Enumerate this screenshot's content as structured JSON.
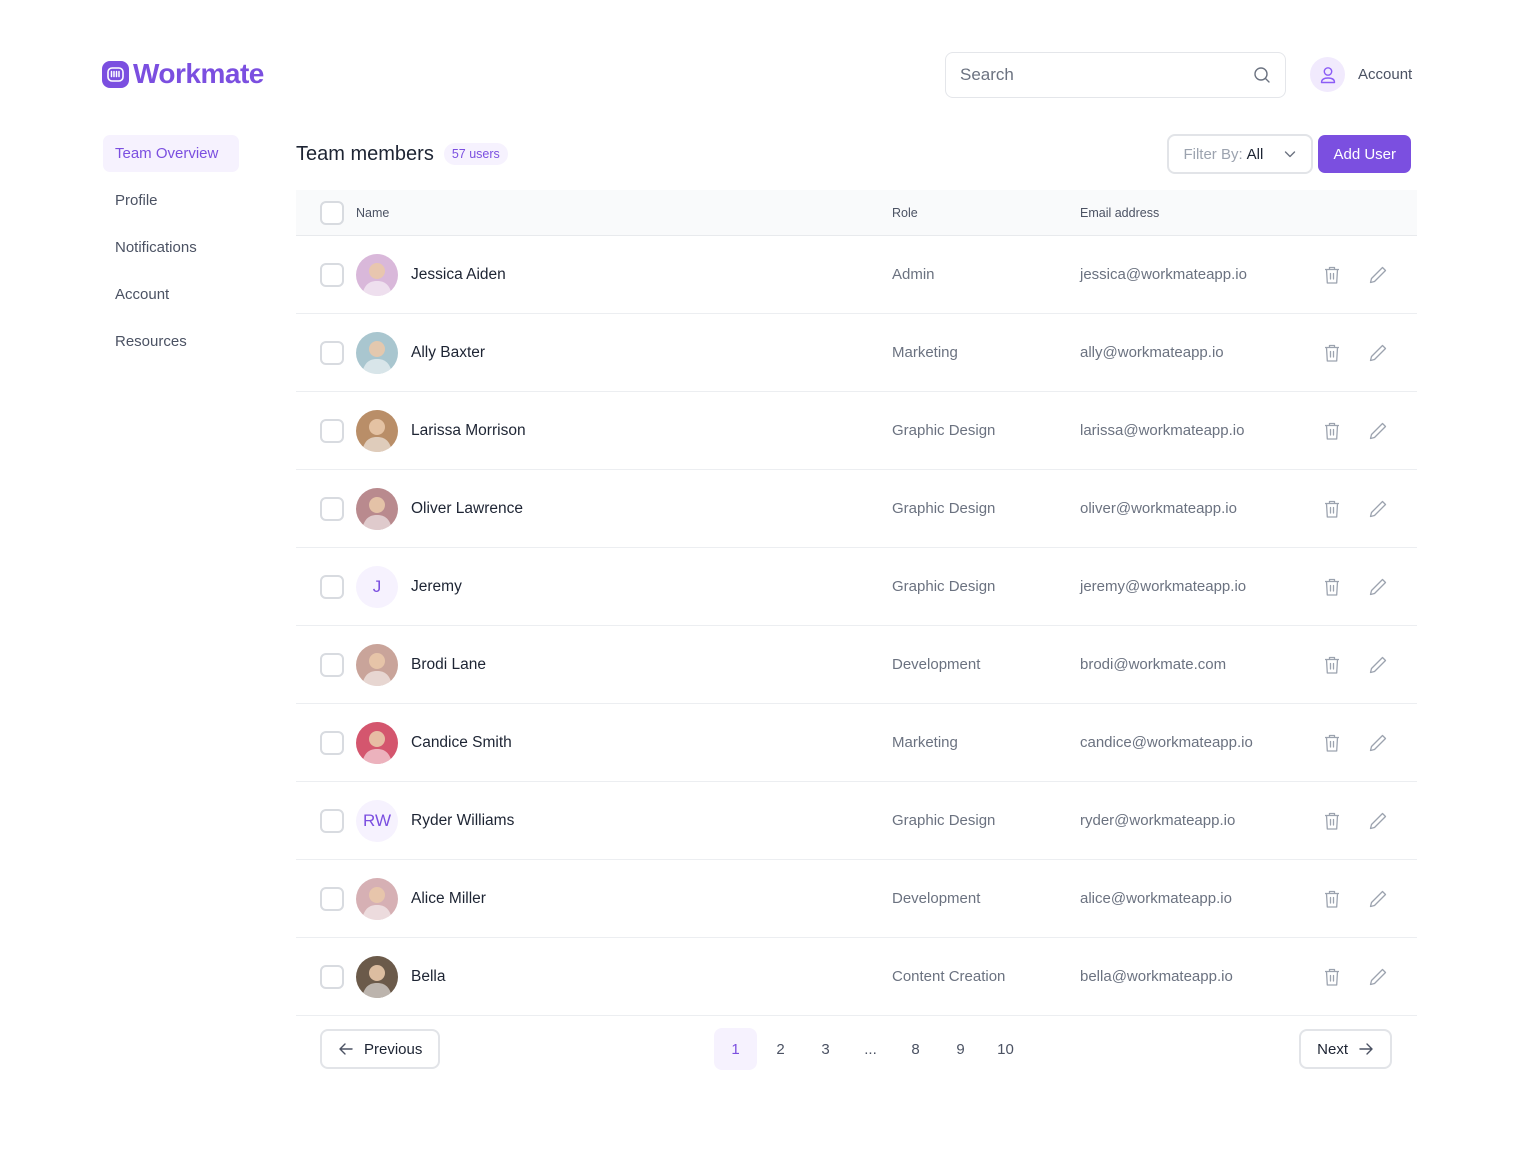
{
  "app": {
    "name": "Workmate",
    "brand_color": "#7b4fe0"
  },
  "header": {
    "search_placeholder": "Search",
    "account_label": "Account"
  },
  "sidebar": {
    "items": [
      {
        "label": "Team Overview",
        "active": true
      },
      {
        "label": "Profile",
        "active": false
      },
      {
        "label": "Notifications",
        "active": false
      },
      {
        "label": "Account",
        "active": false
      },
      {
        "label": "Resources",
        "active": false
      }
    ]
  },
  "main": {
    "title": "Team members",
    "count_badge": "57 users",
    "filter_label": "Filter By:",
    "filter_value": "All",
    "add_user_label": "Add User",
    "columns": {
      "name": "Name",
      "role": "Role",
      "email": "Email address"
    },
    "rows": [
      {
        "name": "Jessica Aiden",
        "role": "Admin",
        "email": "jessica@workmateapp.io",
        "avatar": "photo",
        "avatar_color": "#d9b8da"
      },
      {
        "name": "Ally Baxter",
        "role": "Marketing",
        "email": "ally@workmateapp.io",
        "avatar": "photo",
        "avatar_color": "#a9c6cf"
      },
      {
        "name": "Larissa Morrison",
        "role": "Graphic Design",
        "email": "larissa@workmateapp.io",
        "avatar": "photo",
        "avatar_color": "#b98e68"
      },
      {
        "name": "Oliver Lawrence",
        "role": "Graphic Design",
        "email": "oliver@workmateapp.io",
        "avatar": "photo",
        "avatar_color": "#b98a8e"
      },
      {
        "name": "Jeremy",
        "role": "Graphic Design",
        "email": "jeremy@workmateapp.io",
        "avatar": "initials",
        "initials": "J"
      },
      {
        "name": "Brodi Lane",
        "role": "Development",
        "email": "brodi@workmate.com",
        "avatar": "photo",
        "avatar_color": "#c9a49a"
      },
      {
        "name": "Candice Smith",
        "role": "Marketing",
        "email": "candice@workmateapp.io",
        "avatar": "photo",
        "avatar_color": "#d4566e"
      },
      {
        "name": "Ryder Williams",
        "role": "Graphic Design",
        "email": "ryder@workmateapp.io",
        "avatar": "initials",
        "initials": "RW"
      },
      {
        "name": "Alice Miller",
        "role": "Development",
        "email": "alice@workmateapp.io",
        "avatar": "photo",
        "avatar_color": "#d6b0b4"
      },
      {
        "name": "Bella",
        "role": "Content Creation",
        "email": "bella@workmateapp.io",
        "avatar": "photo",
        "avatar_color": "#6b5a4a"
      }
    ]
  },
  "pagination": {
    "previous_label": "Previous",
    "next_label": "Next",
    "pages": [
      "1",
      "2",
      "3",
      "...",
      "8",
      "9",
      "10"
    ],
    "current_page": "1"
  }
}
